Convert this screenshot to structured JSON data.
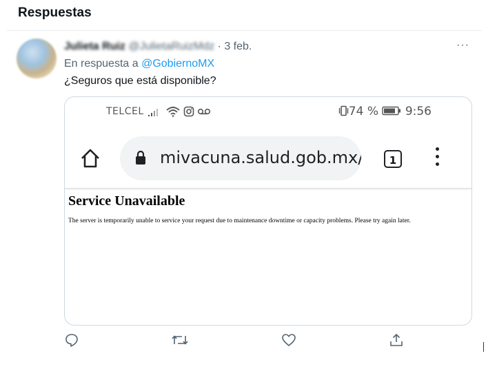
{
  "header": {
    "title": "Respuestas"
  },
  "tweet": {
    "author_name": "Julieta Ruiz",
    "author_handle": "@JulietaRuizMdz",
    "date": "3 feb.",
    "reply_prefix": "En respuesta a",
    "reply_to": "@GobiernoMX",
    "text": "¿Seguros que está disponible?",
    "more": "···"
  },
  "media": {
    "status": {
      "carrier": "TELCEL",
      "battery": "74 %",
      "time": "9:56"
    },
    "browser": {
      "url": "mivacuna.salud.gob.mx/",
      "tabs_count": "1"
    },
    "page": {
      "title": "Service Unavailable",
      "message": "The server is temporarily unable to service your request due to maintenance downtime or capacity problems. Please try again later."
    }
  },
  "actions": {
    "icons": [
      "reply-icon",
      "retweet-icon",
      "like-icon",
      "share-icon"
    ]
  }
}
